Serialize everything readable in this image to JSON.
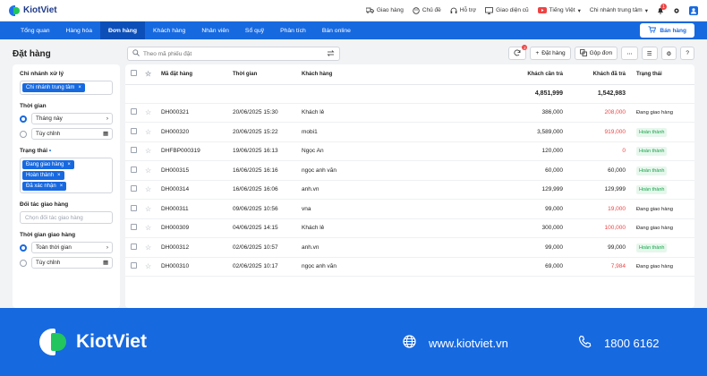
{
  "brand": "KiotViet",
  "topbar": {
    "items": [
      {
        "icon": "truck-icon",
        "label": "Giao hàng"
      },
      {
        "icon": "palette-icon",
        "label": "Chủ đề"
      },
      {
        "icon": "headset-icon",
        "label": "Hỗ trợ"
      },
      {
        "icon": "monitor-icon",
        "label": "Giao diện cũ"
      },
      {
        "icon": "youtube-icon",
        "label": ""
      },
      {
        "icon": "flag-icon",
        "label": "Tiếng Việt"
      },
      {
        "icon": "branch-icon",
        "label": "Chi nhánh trung tâm"
      }
    ],
    "notif_count": "1"
  },
  "nav": {
    "items": [
      "Tổng quan",
      "Hàng hóa",
      "Đơn hàng",
      "Khách hàng",
      "Nhân viên",
      "Sổ quỹ",
      "Phân tích",
      "Bán online"
    ],
    "sell_label": "Bán hàng"
  },
  "page": {
    "title": "Đặt hàng",
    "search_placeholder": "Theo mã phiếu đặt"
  },
  "toolbar": {
    "refresh_badge": "2",
    "add_label": "Đặt hàng",
    "merge_label": "Gộp đơn"
  },
  "filters": {
    "branch_label": "Chi nhánh xử lý",
    "branch_tag": "Chi nhánh trung tâm",
    "time_label": "Thời gian",
    "time_option": "Tháng này",
    "time_custom": "Tùy chỉnh",
    "status_label": "Trạng thái",
    "status_tags": [
      "Đang giao hàng",
      "Hoàn thành",
      "Đã xác nhận"
    ],
    "partner_label": "Đối tác giao hàng",
    "partner_placeholder": "Chọn đối tác giao hàng",
    "delivery_label": "Thời gian giao hàng",
    "delivery_option": "Toàn thời gian",
    "delivery_custom": "Tùy chỉnh"
  },
  "table": {
    "headers": [
      "Mã đặt hàng",
      "Thời gian",
      "Khách hàng",
      "Khách cần trả",
      "Khách đã trả",
      "Trạng thái"
    ],
    "totals": {
      "need": "4,851,999",
      "paid": "1,542,983"
    },
    "rows": [
      {
        "code": "DH000321",
        "time": "20/06/2025 15:30",
        "customer": "Khách lẻ",
        "need": "386,000",
        "paid": "208,000",
        "paid_red": true,
        "status": "Đang giao hàng",
        "status_type": "text"
      },
      {
        "code": "DH000320",
        "time": "20/06/2025 15:22",
        "customer": "mobi1",
        "need": "3,589,000",
        "paid": "919,000",
        "paid_red": true,
        "status": "Hoàn thành",
        "status_type": "green"
      },
      {
        "code": "DHFBP000319",
        "time": "19/06/2025 16:13",
        "customer": "Ngọc An",
        "need": "120,000",
        "paid": "0",
        "paid_red": true,
        "status": "Hoàn thành",
        "status_type": "green"
      },
      {
        "code": "DH000315",
        "time": "16/06/2025 16:16",
        "customer": "ngọc anh văn",
        "need": "60,000",
        "paid": "60,000",
        "paid_red": false,
        "status": "Hoàn thành",
        "status_type": "green"
      },
      {
        "code": "DH000314",
        "time": "16/06/2025 16:06",
        "customer": "anh.vn",
        "need": "129,999",
        "paid": "129,999",
        "paid_red": false,
        "status": "Hoàn thành",
        "status_type": "green"
      },
      {
        "code": "DH000311",
        "time": "09/06/2025 10:56",
        "customer": "vna",
        "need": "99,000",
        "paid": "19,000",
        "paid_red": true,
        "status": "Đang giao hàng",
        "status_type": "text"
      },
      {
        "code": "DH000309",
        "time": "04/06/2025 14:15",
        "customer": "Khách lẻ",
        "need": "300,000",
        "paid": "100,000",
        "paid_red": true,
        "status": "Đang giao hàng",
        "status_type": "text"
      },
      {
        "code": "DH000312",
        "time": "02/06/2025 10:57",
        "customer": "anh.vn",
        "need": "99,000",
        "paid": "99,000",
        "paid_red": false,
        "status": "Hoàn thành",
        "status_type": "green"
      },
      {
        "code": "DH000310",
        "time": "02/06/2025 10:17",
        "customer": "ngọc anh văn",
        "need": "69,000",
        "paid": "7,984",
        "paid_red": true,
        "status": "Đang giao hàng",
        "status_type": "text"
      }
    ]
  },
  "footer": {
    "brand": "KiotViet",
    "website": "www.kiotviet.vn",
    "phone": "1800 6162"
  },
  "colors": {
    "primary": "#1769e0",
    "red": "#ef4444",
    "green": "#16a34a"
  }
}
